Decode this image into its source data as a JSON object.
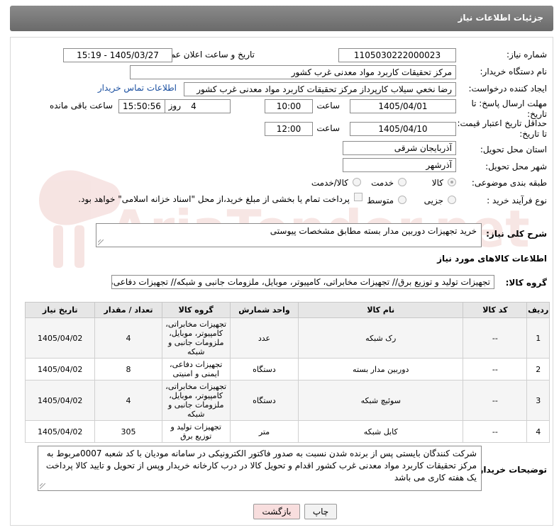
{
  "header": {
    "title": "جزئیات اطلاعات نیاز"
  },
  "fields": {
    "need_number_label": "شماره نیاز:",
    "need_number": "1105030222000023",
    "announce_label": "تاریخ و ساعت اعلان عمومی:",
    "announce_value": "1405/03/27 - 15:19",
    "buyer_org_label": "نام دستگاه خریدار:",
    "buyer_org": "مرکز تحقیقات کاربرد مواد معدنی غرب کشور",
    "creator_label": "ایجاد کننده درخواست:",
    "creator": "رضا نخعي سيلاب كارپرداز مرکز تحقیقات کاربرد مواد معدنی غرب کشور",
    "contact_link": "اطلاعات تماس خریدار",
    "deadline_label": "مهلت ارسال پاسخ: تا تاریخ:",
    "deadline_date": "1405/04/01",
    "time_label": "ساعت",
    "deadline_time": "10:00",
    "days_value": "4",
    "days_label": "روز و",
    "remaining_time": "15:50:56",
    "remaining_label": "ساعت باقی مانده",
    "validity_label": "حداقل تاریخ اعتبار قیمت: تا تاریخ:",
    "validity_date": "1405/04/10",
    "validity_time": "12:00",
    "province_label": "استان محل تحویل:",
    "province": "آذربایجان شرقی",
    "city_label": "شهر محل تحویل:",
    "city": "آذرشهر",
    "category_label": "طبقه بندی موضوعی:",
    "category_options": [
      "کالا",
      "خدمت",
      "کالا/خدمت"
    ],
    "purchase_label": "نوع فرآیند خرید :",
    "purchase_options": [
      "جزیی",
      "متوسط"
    ],
    "treasury_note": "پرداخت تمام یا بخشی از مبلغ خرید،از محل \"اسناد خزانه اسلامی\" خواهد بود."
  },
  "summary": {
    "label": "شرح کلی نیاز:",
    "value": "خرید تجهیزات دوربین مدار بسته مطابق مشخصات پیوستی"
  },
  "goods_section_title": "اطلاعات کالاهای مورد نیاز",
  "goods_group": {
    "label": "گروه کالا:",
    "value": "تجهیزات تولید و توزیع برق// تجهیزات مخابراتی، کامپیوتر، موبایل، ملزومات جانبی و شبکه// تجهیزات دفاعی، ای"
  },
  "table": {
    "headers": [
      "ردیف",
      "کد کالا",
      "نام کالا",
      "واحد شمارش",
      "گروه کالا",
      "تعداد / مقدار",
      "تاریخ نیاز"
    ],
    "rows": [
      [
        "1",
        "--",
        "رک شبکه",
        "عدد",
        "تجهیزات مخابراتی، کامپیوتر، موبایل، ملزومات جانبی و شبکه",
        "4",
        "1405/04/02"
      ],
      [
        "2",
        "--",
        "دوربین مدار بسته",
        "دستگاه",
        "تجهیزات دفاعی، ایمنی و امنیتی",
        "8",
        "1405/04/02"
      ],
      [
        "3",
        "--",
        "سوئیچ شبکه",
        "دستگاه",
        "تجهیزات مخابراتی، کامپیوتر، موبایل، ملزومات جانبی و شبکه",
        "4",
        "1405/04/02"
      ],
      [
        "4",
        "--",
        "کابل شبکه",
        "متر",
        "تجهیزات تولید و توزیع برق",
        "305",
        "1405/04/02"
      ]
    ]
  },
  "buyer_notes": {
    "label": "توضیحات خریدار:",
    "value": "شرکت کنندگان بایستی پس از برنده شدن نسبت به صدور فاکتور الکترونیکی در سامانه مودیان با کد شعبه 0007مربوط به مرکز تحقیقات کاربرد مواد معدنی غرب کشور اقدام و تحویل کالا در درب کارخانه خریدار  وپس از تحویل و تایید کالا پرداخت یک هفته کاری می باشد"
  },
  "buttons": {
    "print": "چاپ",
    "back": "بازگشت"
  },
  "watermark": {
    "text": "AriaTender.net"
  },
  "colors": {
    "header_bg": "#777777",
    "link": "#1a4fa0",
    "back_button": "#f8dede"
  }
}
